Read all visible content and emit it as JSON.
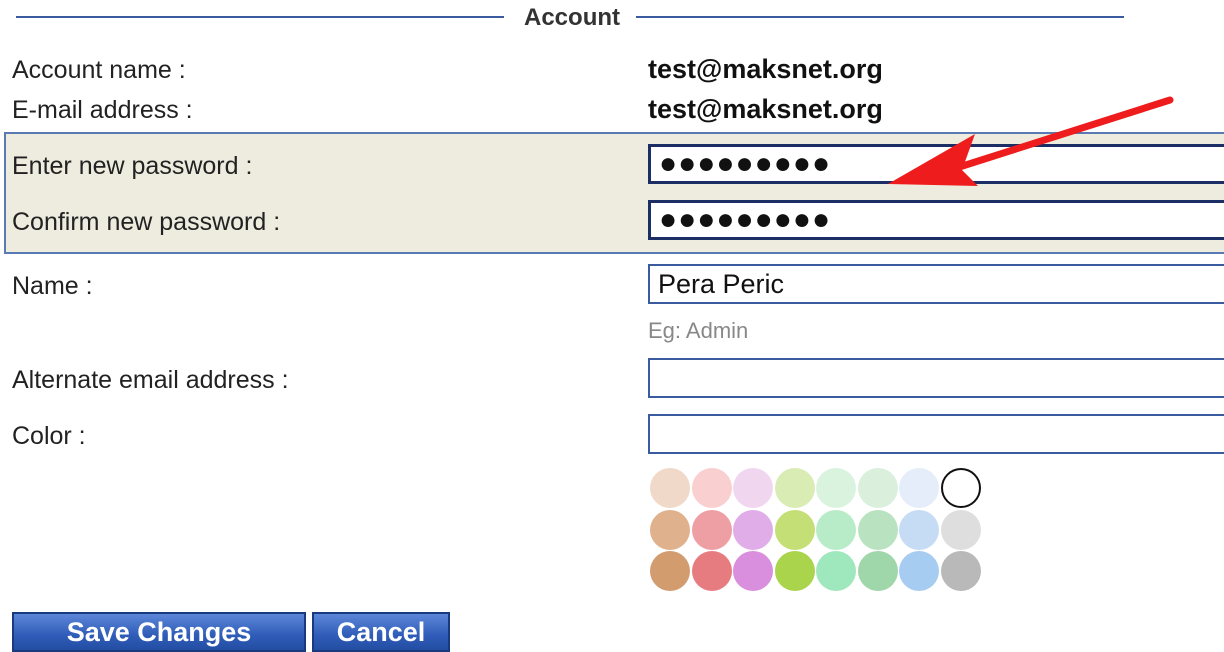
{
  "section": {
    "title": "Account"
  },
  "account": {
    "account_name_label": "Account name :",
    "account_name_value": "test@maksnet.org",
    "email_label": "E-mail address :",
    "email_value": "test@maksnet.org"
  },
  "password": {
    "new_label": "Enter new password :",
    "new_value": "●●●●●●●●●",
    "confirm_label": "Confirm new password :",
    "confirm_value": "●●●●●●●●●"
  },
  "profile": {
    "name_label": "Name :",
    "name_value": "Pera Peric",
    "name_hint": "Eg: Admin",
    "alt_email_label": "Alternate email address :",
    "alt_email_value": "",
    "color_label": "Color :",
    "color_value": ""
  },
  "color_palette": [
    [
      "#f0d9c8",
      "#f9cfd0",
      "#f1d6f0",
      "#d9ecb4",
      "#daf3df",
      "#daf0dd",
      "#e4edf9",
      "selected"
    ],
    [
      "#dfb18c",
      "#ee9fa3",
      "#e0ade8",
      "#c3df75",
      "#b8ecc9",
      "#b9e3c0",
      "#c5dcf4",
      "#dedede"
    ],
    [
      "#d39c6e",
      "#e77c80",
      "#d98fde",
      "#abd44d",
      "#9fe7bd",
      "#9fd6aa",
      "#a7ccf1",
      "#b9b9b9"
    ]
  ],
  "buttons": {
    "save": "Save Changes",
    "cancel": "Cancel"
  },
  "colors": {
    "accent": "#3a5ba0",
    "band": "#eeebdf",
    "annotation_arrow": "#ee1c1c"
  }
}
